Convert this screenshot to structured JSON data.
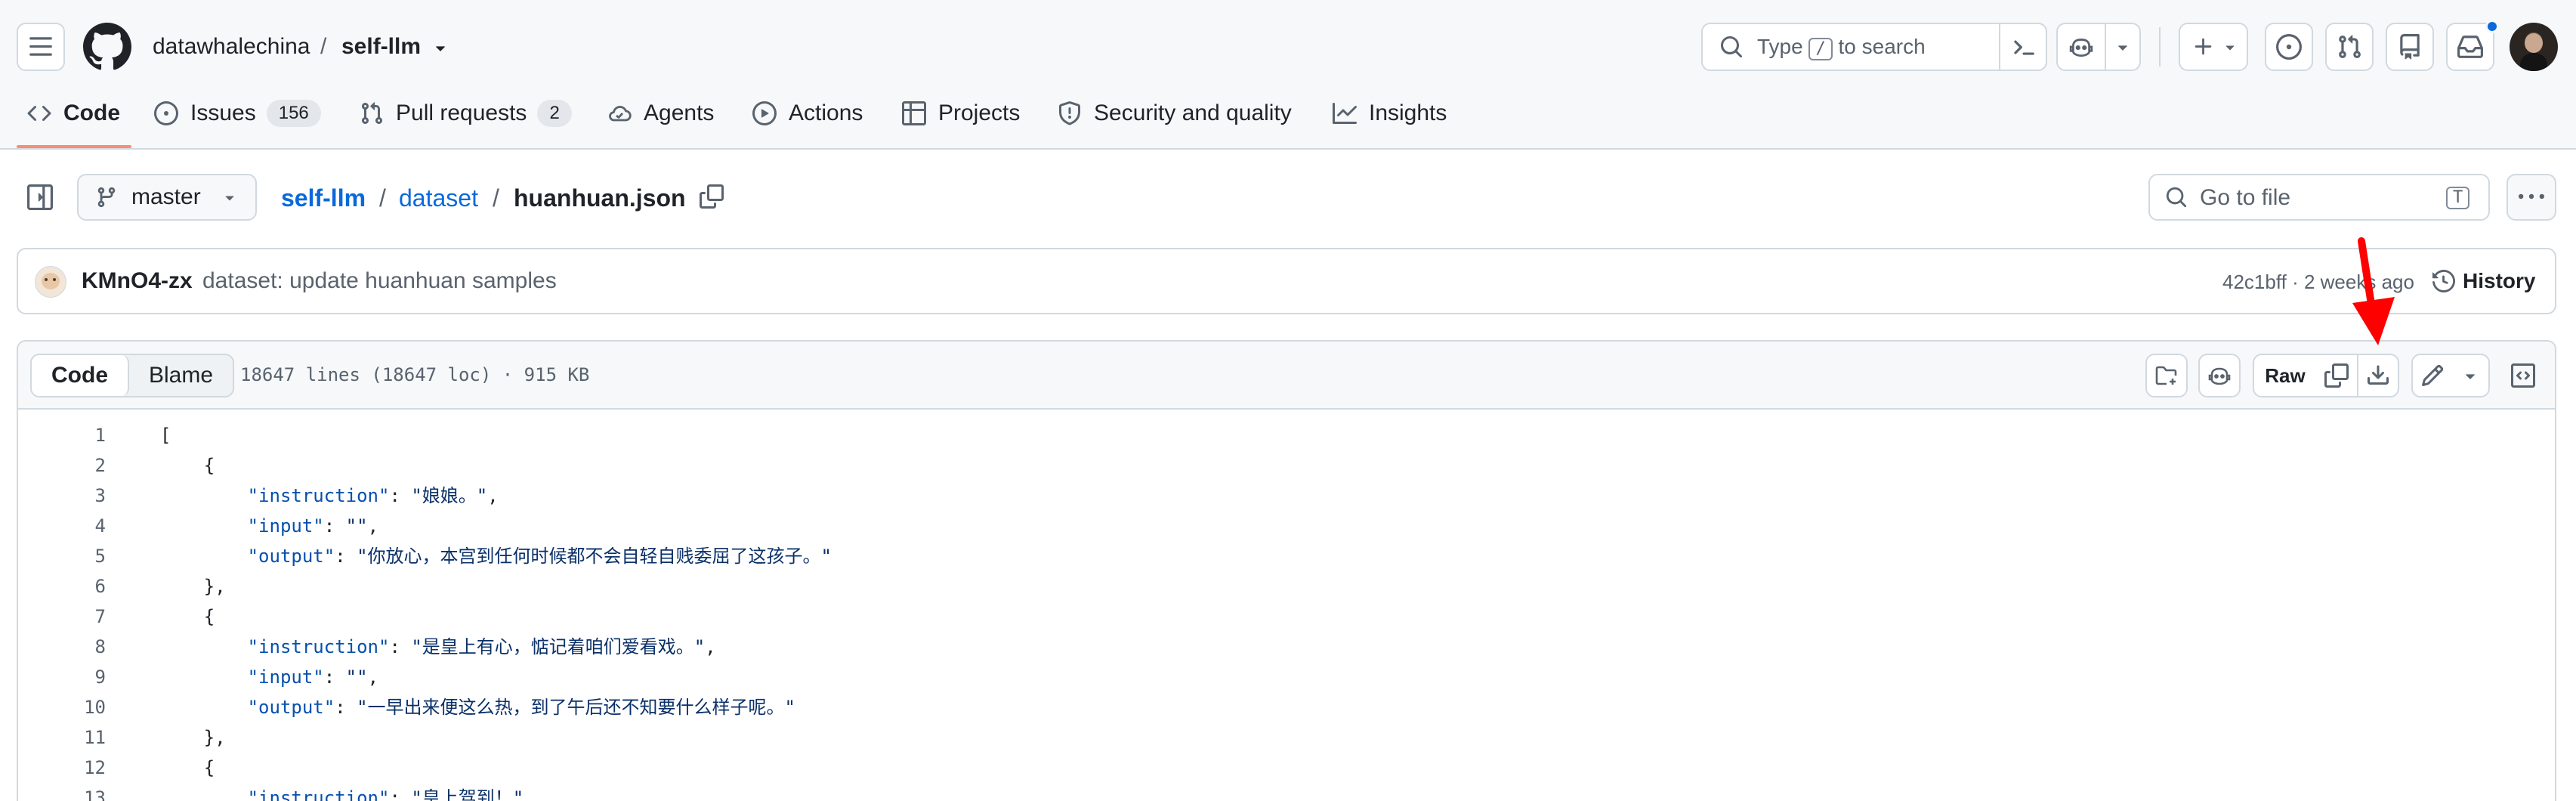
{
  "repo": {
    "owner": "datawhalechina",
    "separator": "/",
    "name": "self-llm"
  },
  "search": {
    "prefix": "Type",
    "key": "/",
    "suffix": "to search"
  },
  "nav_tabs": [
    {
      "label": "Code",
      "icon": "code-icon",
      "active": true
    },
    {
      "label": "Issues",
      "icon": "issue-opened-icon",
      "count": "156"
    },
    {
      "label": "Pull requests",
      "icon": "git-pull-request-icon",
      "count": "2"
    },
    {
      "label": "Agents",
      "icon": "agent-cloud-icon"
    },
    {
      "label": "Actions",
      "icon": "play-circle-icon"
    },
    {
      "label": "Projects",
      "icon": "table-icon"
    },
    {
      "label": "Security and quality",
      "icon": "shield-icon"
    },
    {
      "label": "Insights",
      "icon": "graph-icon"
    }
  ],
  "branch": {
    "name": "master"
  },
  "breadcrumb": {
    "repo": "self-llm",
    "sep": "/",
    "folder": "dataset",
    "file": "huanhuan.json"
  },
  "go_to_file": {
    "label": "Go to file",
    "key": "T"
  },
  "commit": {
    "author": "KMnO4-zx",
    "message": "dataset: update huanhuan samples",
    "sha": "42c1bff",
    "dot": "·",
    "time": "2 weeks ago",
    "history_label": "History"
  },
  "file": {
    "view_code": "Code",
    "view_blame": "Blame",
    "meta": "18647 lines (18647 loc) · 915 KB",
    "raw_label": "Raw"
  },
  "code_lines": [
    {
      "n": "1",
      "kind": "plain",
      "text": "["
    },
    {
      "n": "2",
      "kind": "plain",
      "text": "    {"
    },
    {
      "n": "3",
      "kind": "kv",
      "key": "\"instruction\"",
      "val": "\"娘娘。\"",
      "tail": ","
    },
    {
      "n": "4",
      "kind": "kv",
      "key": "\"input\"",
      "val": "\"\"",
      "tail": ","
    },
    {
      "n": "5",
      "kind": "kv",
      "key": "\"output\"",
      "val": "\"你放心，本宫到任何时候都不会自轻自贱委屈了这孩子。\"",
      "tail": ""
    },
    {
      "n": "6",
      "kind": "plain",
      "text": "    },"
    },
    {
      "n": "7",
      "kind": "plain",
      "text": "    {"
    },
    {
      "n": "8",
      "kind": "kv",
      "key": "\"instruction\"",
      "val": "\"是皇上有心，惦记着咱们爱看戏。\"",
      "tail": ","
    },
    {
      "n": "9",
      "kind": "kv",
      "key": "\"input\"",
      "val": "\"\"",
      "tail": ","
    },
    {
      "n": "10",
      "kind": "kv",
      "key": "\"output\"",
      "val": "\"一早出来便这么热，到了午后还不知要什么样子呢。\"",
      "tail": ""
    },
    {
      "n": "11",
      "kind": "plain",
      "text": "    },"
    },
    {
      "n": "12",
      "kind": "plain",
      "text": "    {"
    },
    {
      "n": "13",
      "kind": "kv",
      "key": "\"instruction\"",
      "val": "\"皇上驾到！\"",
      "tail": ","
    }
  ],
  "colors": {
    "link": "#0969da",
    "annotation_arrow": "#ff0000",
    "underline_active": "#fd8c73",
    "notification_dot": "#0969da"
  }
}
